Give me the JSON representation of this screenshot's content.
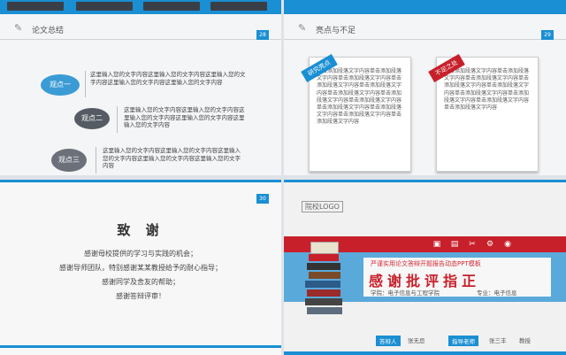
{
  "colors": {
    "accent_blue": "#1a8fd3",
    "accent_red": "#c8202b",
    "bubble_blue": "#3a9bd5",
    "bubble_dark": "#555b63"
  },
  "slide1": {
    "title": "论文总结",
    "page": "28",
    "points": [
      {
        "label": "观点一",
        "text": "这里输入您的文字内容这里输入您的文字内容这里输入您的文字内容这里输入您的文字内容这里输入您的文字内容"
      },
      {
        "label": "观点二",
        "text": "这里输入您的文字内容这里输入您的文字内容这里输入您的文字内容这里输入您的文字内容这里输入您的文字内容"
      },
      {
        "label": "观点三",
        "text": "这里输入您的文字内容这里输入您的文字内容这里输入您的文字内容这里输入您的文字内容这里输入您的文字内容"
      }
    ]
  },
  "slide2": {
    "title": "亮点与不足",
    "page": "29",
    "cards": [
      {
        "ribbon": "研究亮点",
        "text": "单击添加段落文字内容单击添加段落文字内容单击添加段落文字内容单击添加段落文字内容单击添加段落文字内容单击添加段落文字内容单击添加段落文字内容单击添加段落文字内容单击添加段落文字内容单击添加段落文字内容单击添加段落文字内容单击添加段落文字内容"
      },
      {
        "ribbon": "不足之处",
        "text": "单击添加段落文字内容单击添加段落文字内容单击添加段落文字内容单击添加段落文字内容单击添加段落文字内容单击添加段落文字内容单击添加段落文字内容单击添加段落文字内容单击添加段落文字内容"
      }
    ]
  },
  "slide3": {
    "page": "30",
    "title": "致 谢",
    "lines": [
      "感谢母校提供的学习与实践的机会；",
      "感谢导师团队，特别感谢某某教授给予的耐心指导；",
      "感谢同学及舍友的帮助；",
      "感谢答辩评审！"
    ]
  },
  "slide4": {
    "logo": "院校LOGO",
    "subtitle": "严谨实用论文答辩开题报告动态PPT模板",
    "headline": "感谢批评指正",
    "school_label": "学院：电子信息与工程学院",
    "major_label": "专业：电子信息",
    "presenter_tag": "答辩人",
    "presenter": "张无忌",
    "advisor_tag": "指导老师",
    "advisor": "张三丰",
    "advisor_title": "教授",
    "icons": [
      "book-icon",
      "chart-icon",
      "tools-icon",
      "gear-icon",
      "globe-icon"
    ]
  }
}
